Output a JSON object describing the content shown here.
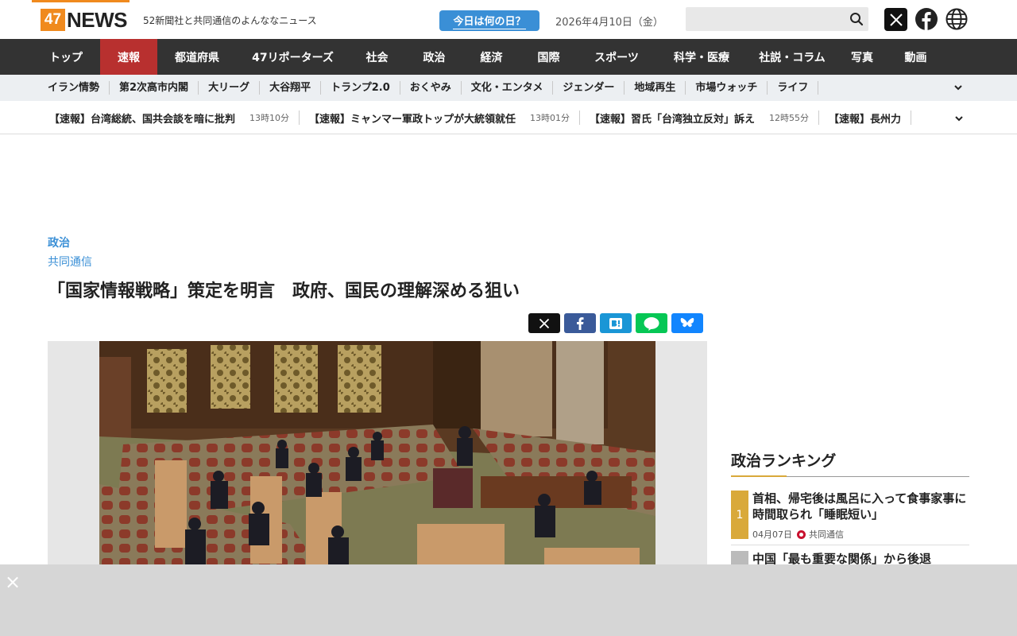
{
  "header": {
    "logo_47": "47",
    "logo_news": "NEWS",
    "tagline": "52新聞社と共同通信のよんななニュース",
    "today_button": "今日は何の日？",
    "date": "2026年4月10日（金）",
    "search_placeholder": ""
  },
  "main_nav": [
    {
      "label": "トップ",
      "width": 86
    },
    {
      "label": "速報",
      "width": 72,
      "active": true
    },
    {
      "label": "都道府県",
      "width": 100
    },
    {
      "label": "47リポーターズ",
      "width": 141
    },
    {
      "label": "社会",
      "width": 71
    },
    {
      "label": "政治",
      "width": 73
    },
    {
      "label": "経済",
      "width": 71
    },
    {
      "label": "国際",
      "width": 73
    },
    {
      "label": "スポーツ",
      "width": 98
    },
    {
      "label": "科学・医療",
      "width": 116
    },
    {
      "label": "社説・コラム",
      "width": 112
    },
    {
      "label": "写真",
      "width": 64
    },
    {
      "label": "動画",
      "width": 71
    }
  ],
  "sub_nav": [
    "イラン情勢",
    "第2次高市内閣",
    "大リーグ",
    "大谷翔平",
    "トランプ2.0",
    "おくやみ",
    "文化・エンタメ",
    "ジェンダー",
    "地域再生",
    "市場ウォッチ",
    "ライフ"
  ],
  "ticker": [
    {
      "text": "【速報】台湾総統、国共会談を暗に批判",
      "time": "13時10分"
    },
    {
      "text": "【速報】ミャンマー軍政トップが大統領就任",
      "time": "13時01分"
    },
    {
      "text": "【速報】習氏「台湾独立反対」訴え",
      "time": "12時55分"
    },
    {
      "text": "【速報】長州力",
      "time": ""
    }
  ],
  "article": {
    "category": "政治",
    "source": "共同通信",
    "headline": "「国家情報戦略」策定を明言　政府、国民の理解深める狙い"
  },
  "ranking": {
    "title": "政治ランキング",
    "items": [
      {
        "rank": "1",
        "text": "首相、帰宅後は風呂に入って食事家事に時間取られ「睡眠短い」",
        "date": "04月07日",
        "source": "共同通信"
      },
      {
        "rank": "",
        "text": "中国「最も重要な関係」から後退"
      }
    ]
  },
  "ad": {
    "close": "×"
  },
  "colors": {
    "brand_orange": "#f08a1e",
    "nav_bg": "#333333",
    "nav_active": "#b8302f",
    "link_blue": "#3a8fd6",
    "rank_gold": "#d9a93a"
  }
}
